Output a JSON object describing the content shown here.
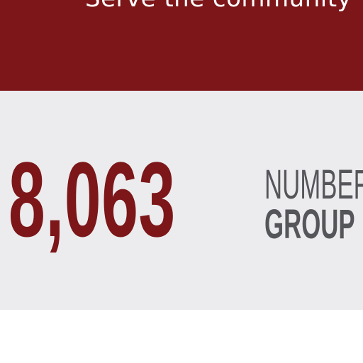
{
  "header": {
    "tagline": "Serve the community"
  },
  "stat": {
    "value": "8,063",
    "label_line1": "NUMBER",
    "label_line2": "GROUP"
  },
  "colors": {
    "brand_red": "#7c1619",
    "panel_gray": "#ececee",
    "label_gray": "#55565a"
  }
}
